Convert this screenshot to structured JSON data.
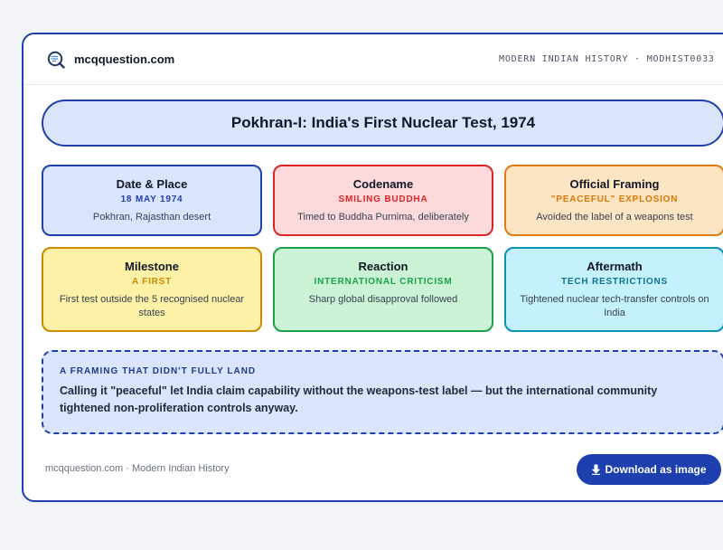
{
  "header": {
    "brand": "mcqquestion.com",
    "breadcrumb": "MODERN INDIAN HISTORY · MODHIST0033",
    "logo_icon": "magnifier-document-icon"
  },
  "title": "Pokhran-I: India's First Nuclear Test, 1974",
  "tiles": [
    {
      "title": "Date & Place",
      "sub": "18 MAY 1974",
      "desc": "Pokhran, Rajasthan desert",
      "color": "#1e40af"
    },
    {
      "title": "Codename",
      "sub": "SMILING BUDDHA",
      "desc": "Timed to Buddha Purnima, deliberately",
      "color": "#dc2626"
    },
    {
      "title": "Official Framing",
      "sub": "\"PEACEFUL\" EXPLOSION",
      "desc": "Avoided the label of a weapons test",
      "color": "#d97706"
    },
    {
      "title": "Milestone",
      "sub": "A FIRST",
      "desc": "First test outside the 5 recognised nuclear states",
      "color": "#ca8a04"
    },
    {
      "title": "Reaction",
      "sub": "INTERNATIONAL CRITICISM",
      "desc": "Sharp global disapproval followed",
      "color": "#16a34a"
    },
    {
      "title": "Aftermath",
      "sub": "TECH RESTRICTIONS",
      "desc": "Tightened nuclear tech-transfer controls on India",
      "color": "#0e7490"
    }
  ],
  "note": {
    "label": "A FRAMING THAT DIDN'T FULLY LAND",
    "text": "Calling it \"peaceful\" let India claim capability without the weapons-test label — but the international community tightened non-proliferation controls anyway."
  },
  "footer": {
    "text": "mcqquestion.com · Modern Indian History",
    "download_label": "Download as image",
    "download_icon": "download-arrow-icon"
  }
}
